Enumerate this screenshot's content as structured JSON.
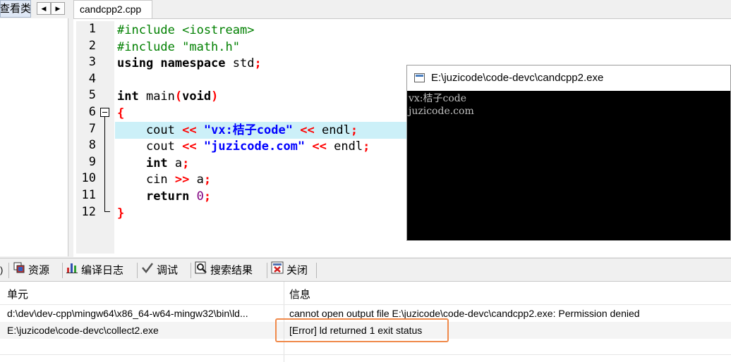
{
  "left_panel": {
    "tab_label": "查看类",
    "prev": "◀",
    "next": "▶"
  },
  "editor_tab": {
    "label": "candcpp2.cpp"
  },
  "line_numbers": [
    "1",
    "2",
    "3",
    "4",
    "5",
    "6",
    "7",
    "8",
    "9",
    "10",
    "11",
    "12"
  ],
  "code_lines": [
    [
      {
        "t": "#include <iostream>",
        "c": "pp"
      }
    ],
    [
      {
        "t": "#include \"math.h\"",
        "c": "pp"
      }
    ],
    [
      {
        "t": "using namespace",
        "c": "kw"
      },
      {
        "t": " std",
        "c": "norm"
      },
      {
        "t": ";",
        "c": "op"
      }
    ],
    [],
    [
      {
        "t": "int",
        "c": "kw"
      },
      {
        "t": " main",
        "c": "norm"
      },
      {
        "t": "(",
        "c": "op"
      },
      {
        "t": "void",
        "c": "kw"
      },
      {
        "t": ")",
        "c": "op"
      }
    ],
    [
      {
        "t": "{",
        "c": "op"
      }
    ],
    [
      {
        "t": "    cout ",
        "c": "norm"
      },
      {
        "t": "<<",
        "c": "op"
      },
      {
        "t": " ",
        "c": "norm"
      },
      {
        "t": "\"vx:桔子code\"",
        "c": "str"
      },
      {
        "t": " ",
        "c": "norm"
      },
      {
        "t": "<<",
        "c": "op"
      },
      {
        "t": " endl",
        "c": "norm"
      },
      {
        "t": ";",
        "c": "op"
      }
    ],
    [
      {
        "t": "    cout ",
        "c": "norm"
      },
      {
        "t": "<<",
        "c": "op"
      },
      {
        "t": " ",
        "c": "norm"
      },
      {
        "t": "\"juzicode.com\"",
        "c": "str"
      },
      {
        "t": " ",
        "c": "norm"
      },
      {
        "t": "<<",
        "c": "op"
      },
      {
        "t": " endl",
        "c": "norm"
      },
      {
        "t": ";",
        "c": "op"
      }
    ],
    [
      {
        "t": "    ",
        "c": "norm"
      },
      {
        "t": "int",
        "c": "kw"
      },
      {
        "t": " a",
        "c": "norm"
      },
      {
        "t": ";",
        "c": "op"
      }
    ],
    [
      {
        "t": "    cin ",
        "c": "norm"
      },
      {
        "t": ">>",
        "c": "op"
      },
      {
        "t": " a",
        "c": "norm"
      },
      {
        "t": ";",
        "c": "op"
      }
    ],
    [
      {
        "t": "    ",
        "c": "norm"
      },
      {
        "t": "return",
        "c": "kw"
      },
      {
        "t": " ",
        "c": "norm"
      },
      {
        "t": "0",
        "c": "num"
      },
      {
        "t": ";",
        "c": "op"
      }
    ],
    [
      {
        "t": "}",
        "c": "op"
      }
    ]
  ],
  "console": {
    "title": "E:\\juzicode\\code-devc\\candcpp2.exe",
    "lines": [
      "vx:桔子code",
      "juzicode.com"
    ]
  },
  "bottom_tabs": [
    {
      "label": "资源",
      "icon": "resources-icon"
    },
    {
      "label": "编译日志",
      "icon": "compile-log-icon"
    },
    {
      "label": "调试",
      "icon": "debug-icon"
    },
    {
      "label": "搜索结果",
      "icon": "search-results-icon"
    },
    {
      "label": "关闭",
      "icon": "close-icon"
    }
  ],
  "messages": {
    "headers": {
      "unit": "单元",
      "info": "信息"
    },
    "rows": [
      {
        "unit": "d:\\dev\\dev-cpp\\mingw64\\x86_64-w64-mingw32\\bin\\ld...",
        "info": "cannot open output file E:\\juzicode\\code-devc\\candcpp2.exe: Permission denied"
      },
      {
        "unit": "E:\\juzicode\\code-devc\\collect2.exe",
        "info": "[Error] ld returned 1 exit status"
      }
    ]
  },
  "colors": {
    "highlight_line": "#ccf0f8",
    "error_box": "#f08a4b",
    "console_bg": "#000000"
  }
}
